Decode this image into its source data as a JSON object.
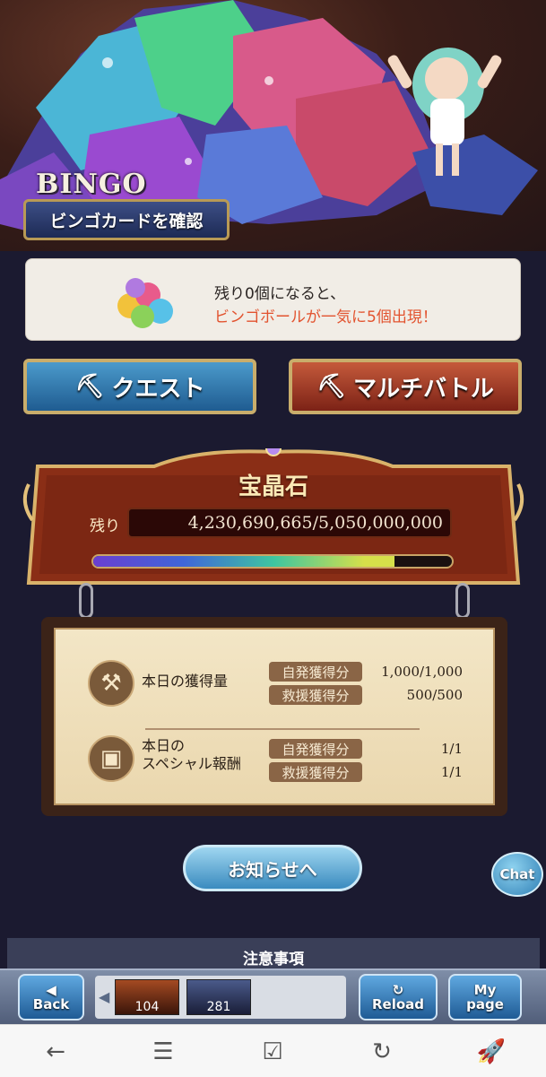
{
  "bingo": {
    "title": "BINGO",
    "check_card_label": "ビンゴカードを確認"
  },
  "info": {
    "line1": "残り0個になると、",
    "line2": "ビンゴボールが一気に5個出現！"
  },
  "buttons": {
    "quest_label": "クエスト",
    "multi_label": "マルチバトル"
  },
  "gem": {
    "title": "宝晶石",
    "remaining_label": "残り",
    "remaining_value": "4,230,690,665/5,050,000,000",
    "progress_fraction": 0.84
  },
  "stats": {
    "daily_label": "本日の獲得量",
    "special_label_1": "本日の",
    "special_label_2": "スペシャル報酬",
    "self_pill": "自発獲得分",
    "rescue_pill": "救援獲得分",
    "daily_self_value": "1,000/1,000",
    "daily_rescue_value": "500/500",
    "special_self_value": "1/1",
    "special_rescue_value": "1/1"
  },
  "news_button_label": "お知らせへ",
  "chat_label": "Chat",
  "notice_heading": "注意事項",
  "footer": {
    "back_label": "Back",
    "reload_label": "Reload",
    "mypage_label_1": "My",
    "mypage_label_2": "page",
    "thumb1_count": "104",
    "thumb2_count": "281"
  },
  "icons": {
    "nav_back": "arrow-left-icon",
    "nav_menu": "menu-icon",
    "nav_check": "checkbox-icon",
    "nav_reload": "reload-icon",
    "nav_rocket": "rocket-icon"
  },
  "colors": {
    "accent_orange": "#e2532f",
    "quest_blue": "#1f5c91",
    "multi_red": "#7c2216"
  }
}
